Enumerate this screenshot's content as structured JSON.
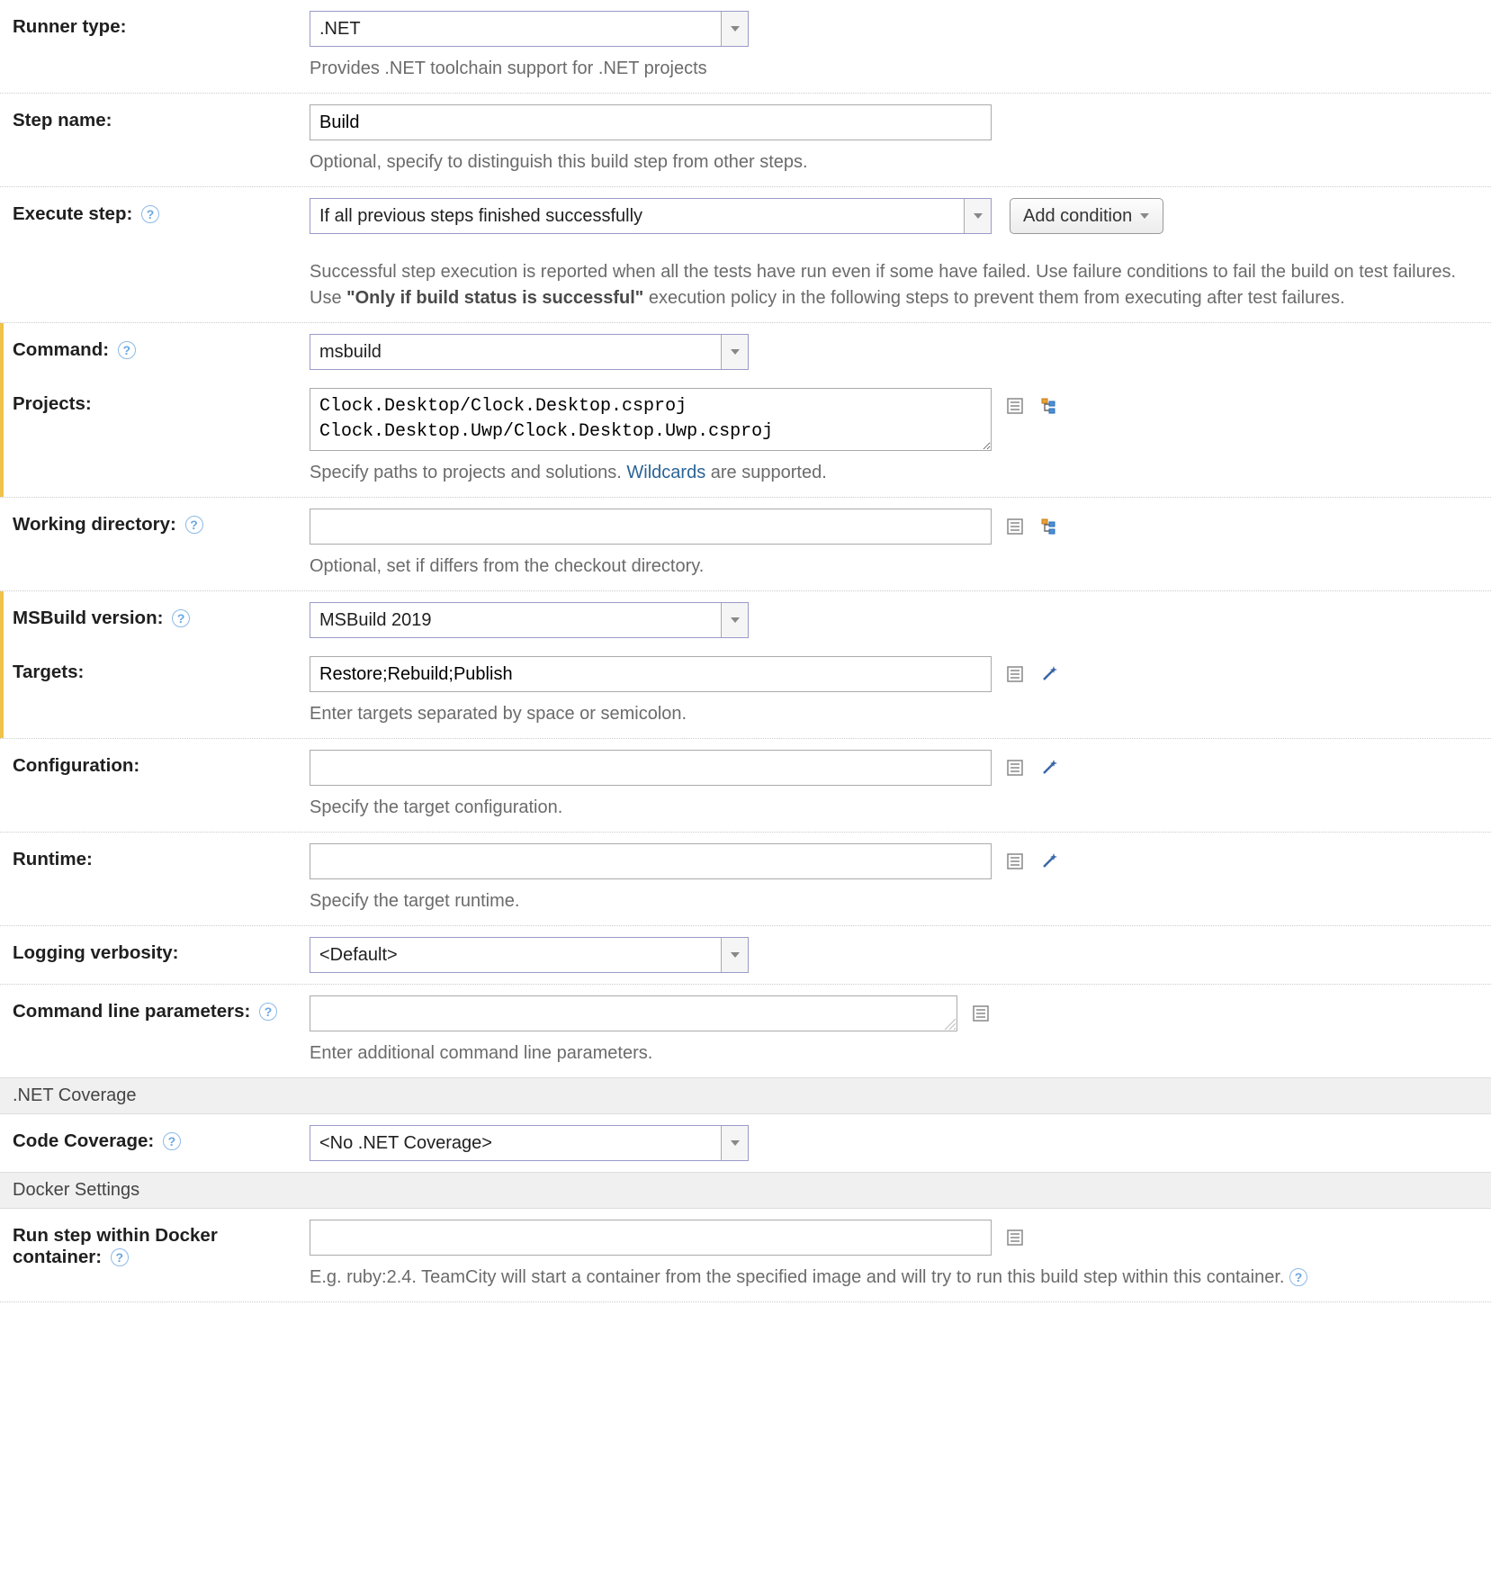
{
  "runnerType": {
    "label": "Runner type:",
    "value": ".NET",
    "hint": "Provides .NET toolchain support for .NET projects"
  },
  "stepName": {
    "label": "Step name:",
    "value": "Build",
    "hint": "Optional, specify to distinguish this build step from other steps."
  },
  "executeStep": {
    "label": "Execute step:",
    "value": "If all previous steps finished successfully",
    "button": "Add condition",
    "hint_pre": "Successful step execution is reported when all the tests have run even if some have failed. Use failure conditions to fail the build on test failures. Use ",
    "hint_bold": "\"Only if build status is successful\"",
    "hint_post": " execution policy in the following steps to prevent them from executing after test failures."
  },
  "command": {
    "label": "Command:",
    "value": "msbuild"
  },
  "projects": {
    "label": "Projects:",
    "value": "Clock.Desktop/Clock.Desktop.csproj\nClock.Desktop.Uwp/Clock.Desktop.Uwp.csproj",
    "hint_pre": "Specify paths to projects and solutions. ",
    "hint_link": "Wildcards",
    "hint_post": " are supported."
  },
  "workingDir": {
    "label": "Working directory:",
    "value": "",
    "hint": "Optional, set if differs from the checkout directory."
  },
  "msbuildVersion": {
    "label": "MSBuild version:",
    "value": "MSBuild 2019"
  },
  "targets": {
    "label": "Targets:",
    "value": "Restore;Rebuild;Publish",
    "hint": "Enter targets separated by space or semicolon."
  },
  "configuration": {
    "label": "Configuration:",
    "value": "",
    "hint": "Specify the target configuration."
  },
  "runtime": {
    "label": "Runtime:",
    "value": "",
    "hint": "Specify the target runtime."
  },
  "loggingVerbosity": {
    "label": "Logging verbosity:",
    "value": "<Default>"
  },
  "cmdLineParams": {
    "label": "Command line parameters:",
    "value": "",
    "hint": "Enter additional command line parameters."
  },
  "sections": {
    "coverage": ".NET Coverage",
    "docker": "Docker Settings"
  },
  "codeCoverage": {
    "label": "Code Coverage:",
    "value": "<No .NET Coverage>"
  },
  "docker": {
    "label": "Run step within Docker container:",
    "value": "",
    "hint": "E.g. ruby:2.4. TeamCity will start a container from the specified image and will try to run this build step within this container."
  }
}
